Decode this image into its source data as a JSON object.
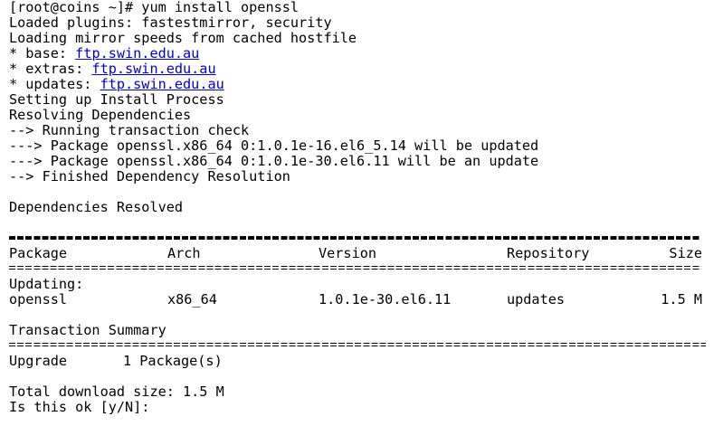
{
  "terminal": {
    "command_line": "[root@coins ~]# yum install openssl",
    "plugins_line": "Loaded plugins: fastestmirror, security",
    "mirror_line": "Loading mirror speeds from cached hostfile",
    "mirrors": [
      {
        "prefix": "* base: ",
        "host": "ftp.swin.edu.au"
      },
      {
        "prefix": "* extras: ",
        "host": "ftp.swin.edu.au"
      },
      {
        "prefix": "* updates: ",
        "host": "ftp.swin.edu.au"
      }
    ],
    "log": [
      "Setting up Install Process",
      "Resolving Dependencies",
      "--> Running transaction check",
      "---> Package openssl.x86_64 0:1.0.1e-16.el6_5.14 will be updated",
      "---> Package openssl.x86_64 0:1.0.1e-30.el6.11 will be an update",
      "--> Finished Dependency Resolution"
    ],
    "deps_resolved": "Dependencies Resolved",
    "table": {
      "headers": {
        "package": "Package",
        "arch": "Arch",
        "version": "Version",
        "repository": "Repository",
        "size": "Size"
      },
      "section_label": "Updating:",
      "rows": [
        {
          "package": "openssl",
          "arch": "x86_64",
          "version": "1.0.1e-30.el6.11",
          "repository": "updates",
          "size": "1.5 M"
        }
      ]
    },
    "summary": {
      "title": "Transaction Summary",
      "action": "Upgrade",
      "count": "1 Package(s)"
    },
    "total_download": "Total download size: 1.5 M",
    "confirm_prompt": "Is this ok [y/N]:"
  }
}
